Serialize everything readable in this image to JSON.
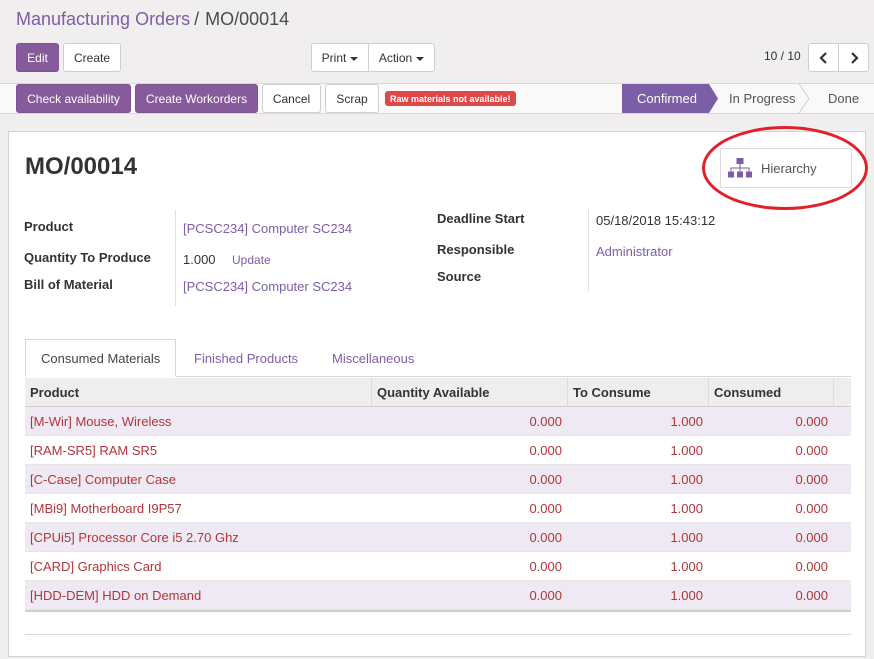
{
  "breadcrumb": {
    "parent": "Manufacturing Orders",
    "separator": "/",
    "current": "MO/00014"
  },
  "buttons": {
    "edit": "Edit",
    "create": "Create",
    "print": "Print",
    "action": "Action",
    "check_availability": "Check availability",
    "create_workorders": "Create Workorders",
    "cancel": "Cancel",
    "scrap": "Scrap",
    "hierarchy": "Hierarchy"
  },
  "pager": {
    "value": "10 / 10"
  },
  "alert_badge": "Raw materials not available!",
  "statusbar": {
    "stages": [
      "Confirmed",
      "In Progress",
      "Done"
    ],
    "active": "Confirmed"
  },
  "record": {
    "name": "MO/00014",
    "left_fields": [
      {
        "label": "Product",
        "value": "[PCSC234] Computer SC234"
      },
      {
        "label": "Quantity To Produce",
        "value": "1.000",
        "action": "Update"
      },
      {
        "label": "Bill of Material",
        "value": "[PCSC234] Computer SC234"
      }
    ],
    "right_fields": [
      {
        "label": "Deadline Start",
        "value": "05/18/2018 15:43:12"
      },
      {
        "label": "Responsible",
        "value": "Administrator"
      },
      {
        "label": "Source",
        "value": ""
      }
    ]
  },
  "tabs": [
    {
      "label": "Consumed Materials",
      "active": true
    },
    {
      "label": "Finished Products",
      "active": false
    },
    {
      "label": "Miscellaneous",
      "active": false
    }
  ],
  "table": {
    "columns": [
      "Product",
      "Quantity Available",
      "To Consume",
      "Consumed"
    ],
    "rows": [
      [
        "[M-Wir] Mouse, Wireless",
        "0.000",
        "1.000",
        "0.000"
      ],
      [
        "[RAM-SR5] RAM SR5",
        "0.000",
        "1.000",
        "0.000"
      ],
      [
        "[C-Case] Computer Case",
        "0.000",
        "1.000",
        "0.000"
      ],
      [
        "[MBi9] Motherboard I9P57",
        "0.000",
        "1.000",
        "0.000"
      ],
      [
        "[CPUi5] Processor Core i5 2.70 Ghz",
        "0.000",
        "1.000",
        "0.000"
      ],
      [
        "[CARD] Graphics Card",
        "0.000",
        "1.000",
        "0.000"
      ],
      [
        "[HDD-DEM] HDD on Demand",
        "0.000",
        "1.000",
        "0.000"
      ]
    ]
  },
  "colors": {
    "brand": "#875a9b",
    "link": "#7c5ea6",
    "danger": "#e04848",
    "row_text": "#b0363a",
    "annotation": "#e0202a"
  },
  "icons": {
    "hierarchy": "sitemap-icon",
    "pager_prev": "chevron-left-icon",
    "pager_next": "chevron-right-icon"
  }
}
